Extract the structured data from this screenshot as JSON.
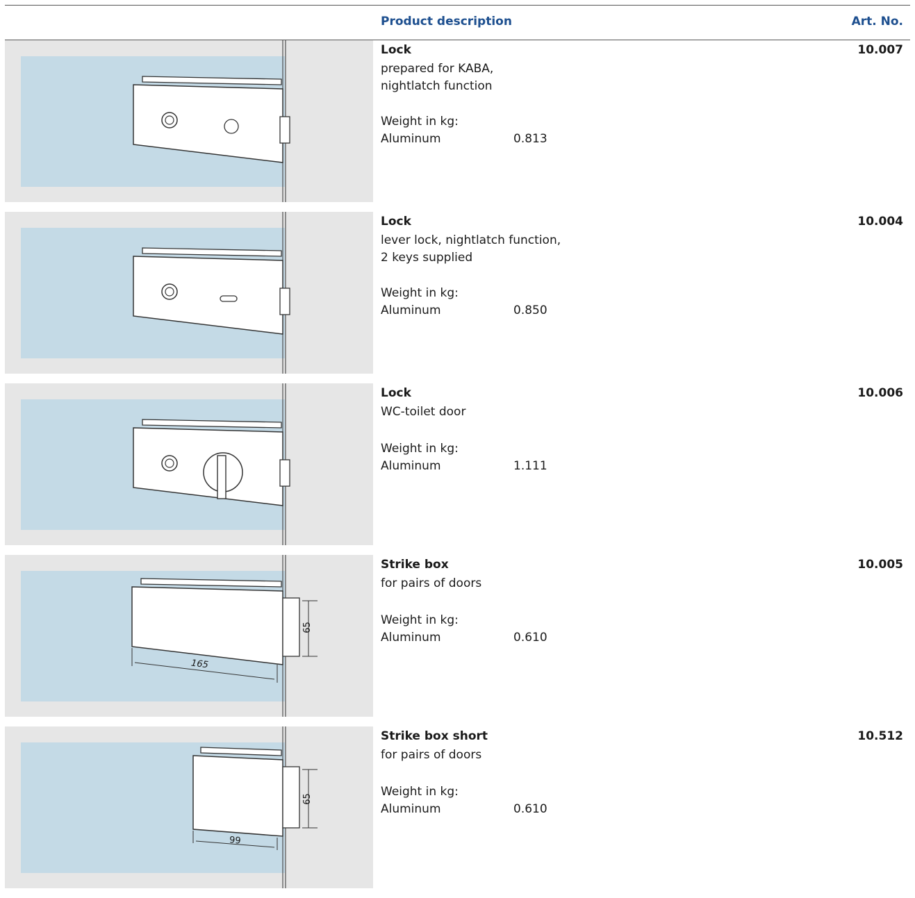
{
  "header": {
    "description_label": "Product description",
    "art_no_label": "Art. No."
  },
  "colors": {
    "header_text": "#1d4f8f",
    "glass": "#c4dae6",
    "panel_bg": "#e6e6e6"
  },
  "products": [
    {
      "title": "Lock",
      "lines": [
        "prepared for KABA,",
        "nightlatch function"
      ],
      "weight_label": "Weight in kg:",
      "material": "Aluminum",
      "weight": "0.813",
      "art_no": "10.007",
      "illustration": "lock-kaba-icon"
    },
    {
      "title": "Lock",
      "lines": [
        "lever lock, nightlatch function,",
        "2 keys supplied"
      ],
      "weight_label": "Weight in kg:",
      "material": "Aluminum",
      "weight": "0.850",
      "art_no": "10.004",
      "illustration": "lock-lever-icon"
    },
    {
      "title": "Lock",
      "lines": [
        "WC-toilet door"
      ],
      "weight_label": "Weight in kg:",
      "material": "Aluminum",
      "weight": "1.111",
      "art_no": "10.006",
      "illustration": "lock-wc-icon"
    },
    {
      "title": "Strike box",
      "lines": [
        "for pairs of doors"
      ],
      "weight_label": "Weight in kg:",
      "material": "Aluminum",
      "weight": "0.610",
      "art_no": "10.005",
      "illustration": "strike-box-icon",
      "dimensions": {
        "width": "165",
        "height": "65"
      }
    },
    {
      "title": "Strike box short",
      "lines": [
        "for pairs of doors"
      ],
      "weight_label": "Weight in kg:",
      "material": "Aluminum",
      "weight": "0.610",
      "art_no": "10.512",
      "illustration": "strike-box-short-icon",
      "dimensions": {
        "width": "99",
        "height": "65"
      }
    }
  ]
}
